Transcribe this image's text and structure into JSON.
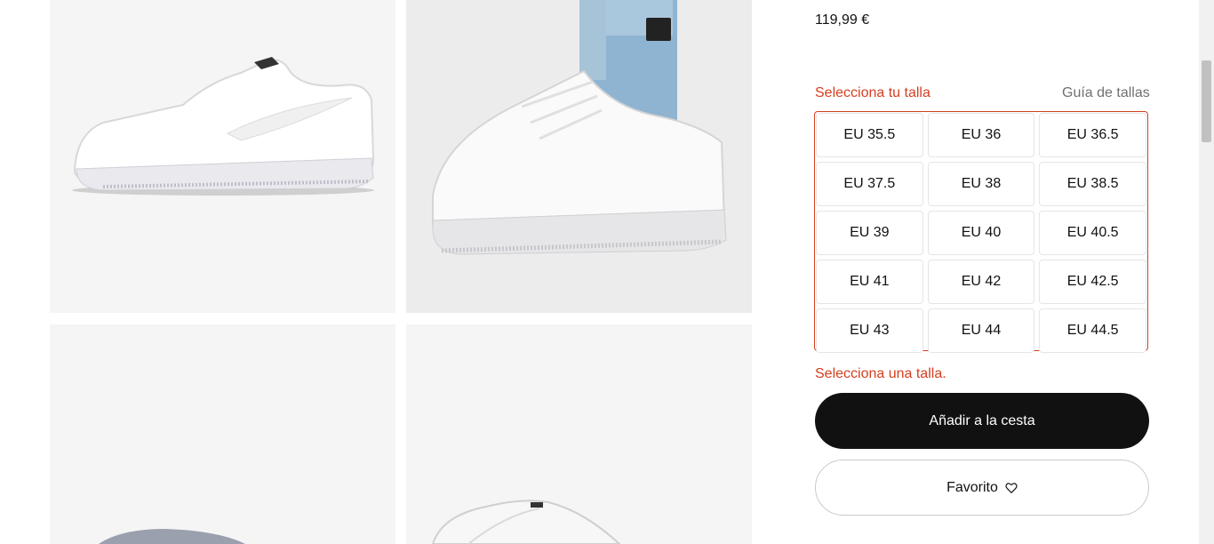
{
  "product": {
    "price": "119,99 €"
  },
  "size_selector": {
    "label": "Selecciona tu talla",
    "guide_link": "Guía de tallas",
    "sizes": [
      "EU 35.5",
      "EU 36",
      "EU 36.5",
      "EU 37.5",
      "EU 38",
      "EU 38.5",
      "EU 39",
      "EU 40",
      "EU 40.5",
      "EU 41",
      "EU 42",
      "EU 42.5",
      "EU 43",
      "EU 44",
      "EU 44.5"
    ],
    "error": "Selecciona una talla."
  },
  "actions": {
    "add_to_bag": "Añadir a la cesta",
    "favorite": "Favorito",
    "favorite_icon": "heart-icon"
  },
  "colors": {
    "accent_error": "#d43f21",
    "primary_button": "#111111"
  }
}
